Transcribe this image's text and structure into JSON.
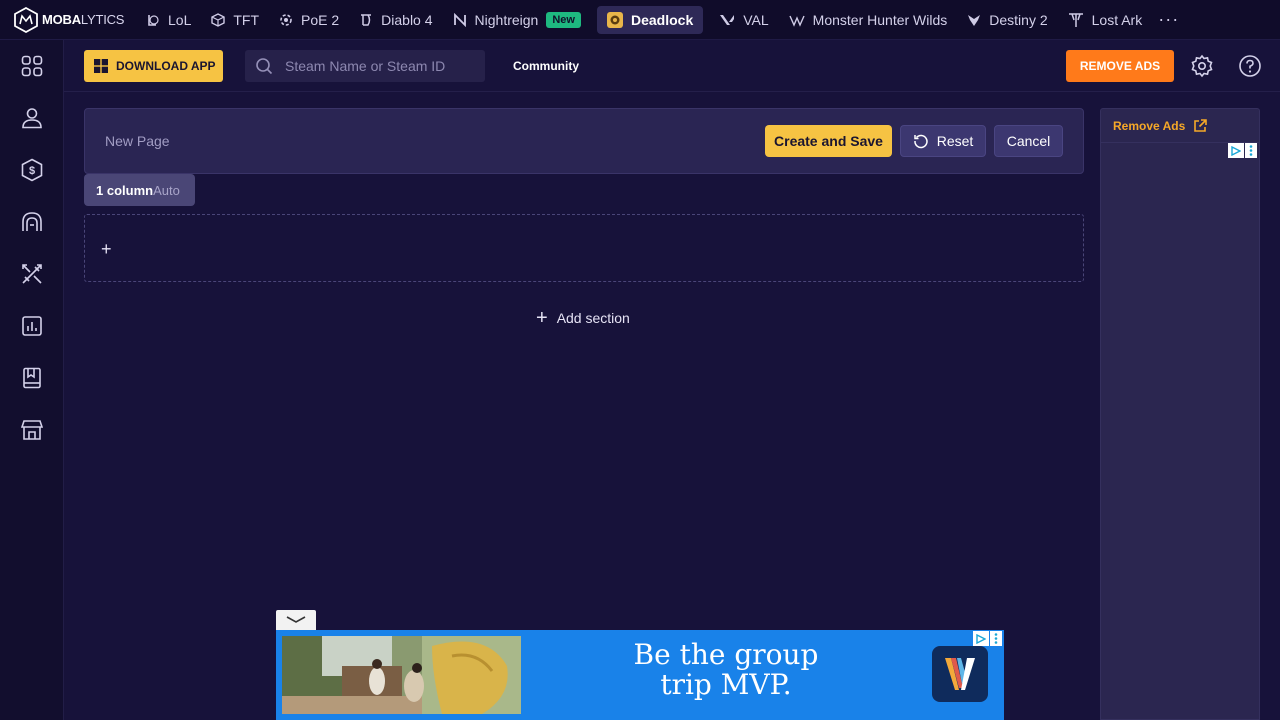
{
  "topbar": {
    "logo": {
      "bold": "MOBA",
      "thin": "LYTICS"
    },
    "games": [
      {
        "label": "LoL",
        "icon": "lol-icon"
      },
      {
        "label": "TFT",
        "icon": "tft-icon"
      },
      {
        "label": "PoE 2",
        "icon": "poe2-icon"
      },
      {
        "label": "Diablo 4",
        "icon": "diablo4-icon"
      },
      {
        "label": "Nightreign",
        "icon": "nightreign-icon",
        "badge": "New"
      },
      {
        "label": "Deadlock",
        "icon": "deadlock-icon",
        "active": true
      },
      {
        "label": "VAL",
        "icon": "valorant-icon"
      },
      {
        "label": "Monster Hunter Wilds",
        "icon": "mhw-icon"
      },
      {
        "label": "Destiny 2",
        "icon": "destiny2-icon"
      },
      {
        "label": "Lost Ark",
        "icon": "lostark-icon"
      }
    ],
    "more": "···"
  },
  "sidebar": {
    "items": [
      "grid-icon",
      "profile-icon",
      "currency-icon",
      "heroes-icon",
      "builds-icon",
      "stats-icon",
      "guides-icon",
      "shop-icon"
    ]
  },
  "header": {
    "download_label": "DOWNLOAD APP",
    "search_placeholder": "Steam Name or Steam ID",
    "community_label": "Community",
    "remove_ads_label": "REMOVE ADS"
  },
  "editor": {
    "page_name_placeholder": "New Page",
    "create_label": "Create and Save",
    "reset_label": "Reset",
    "cancel_label": "Cancel",
    "columns_label": "1 column",
    "columns_mode": "Auto",
    "section_plus": "+",
    "add_section_plus": "+",
    "add_section_label": "Add section"
  },
  "ad_column": {
    "remove_ads_link": "Remove Ads"
  },
  "bottom_ad": {
    "headline_line1": "Be the group",
    "headline_line2": "trip MVP."
  },
  "colors": {
    "background": "#17123a",
    "accent_yellow": "#f6c343",
    "accent_orange": "#ff7a1a",
    "ad_blue": "#1982e9"
  }
}
